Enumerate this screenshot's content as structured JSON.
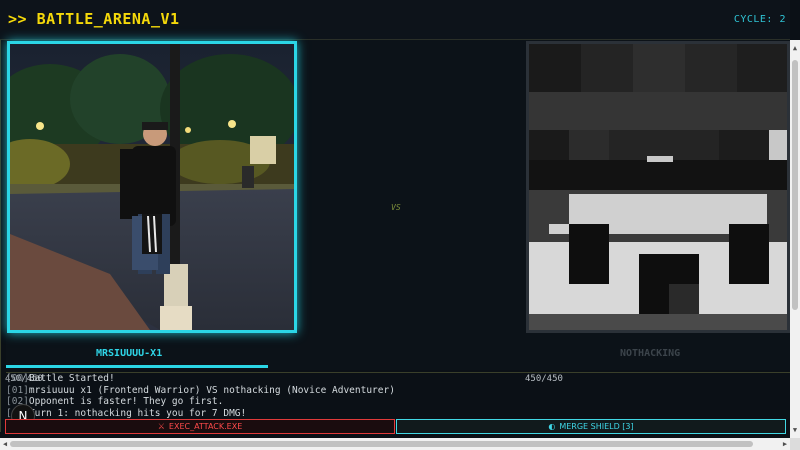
{
  "header": {
    "title": ">> BATTLE_ARENA_V1",
    "cycle": "CYCLE: 2"
  },
  "player": {
    "name": "MRSIUUUU-X1",
    "hp": "450/450",
    "hp_fraction": 1.0,
    "accent": "#2bd6e6"
  },
  "vs_label": "VS",
  "enemy": {
    "name": "NOTHACKING",
    "hp": "450/450",
    "hp_fraction": 1.0
  },
  "log": [
    {
      "idx": "[00]",
      "text": "Battle Started!"
    },
    {
      "idx": "[01]",
      "text": "mrsiuuuu x1 (Frontend Warrior) VS nothacking (Novice Adventurer)"
    },
    {
      "idx": "[02]",
      "text": "Opponent is faster! They go first."
    },
    {
      "idx": "[03]",
      "text": "Turn 1: nothacking hits you for 7 DMG!"
    }
  ],
  "actions": {
    "attack_label": "EXEC_ATTACK.EXE",
    "attack_icon": "crossed-swords-icon",
    "shield_label": "MERGE SHIELD [3]",
    "shield_icon": "shield-icon",
    "attack_color": "#e03a3a",
    "shield_color": "#42d8e4"
  },
  "cursor_badge": "N",
  "colors": {
    "title": "#f5d90a",
    "cyan": "#2bd6e6",
    "background": "#0b1016"
  }
}
